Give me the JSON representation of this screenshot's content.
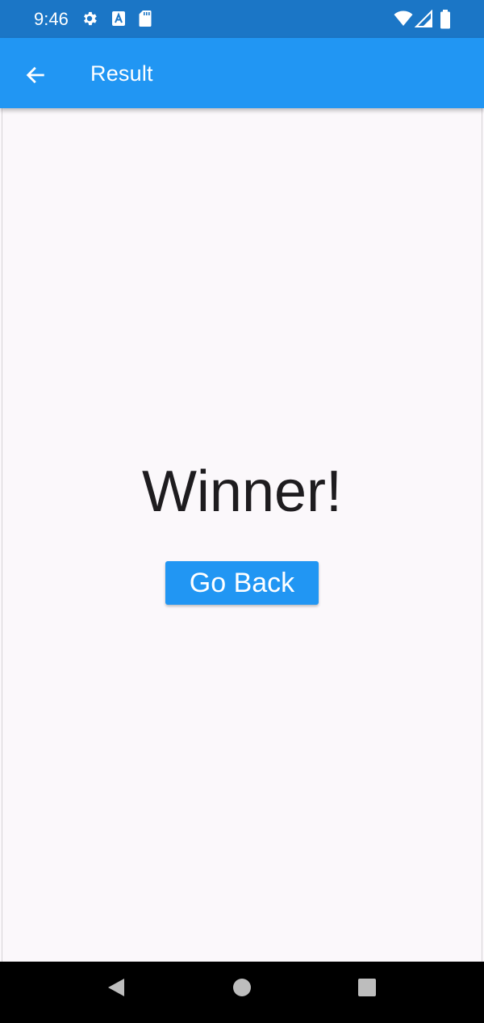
{
  "status_bar": {
    "time": "9:46",
    "left_icons": [
      "gear-icon",
      "a-badge-icon",
      "sd-card-icon"
    ],
    "right_icons": [
      "wifi-icon",
      "signal-icon",
      "battery-icon"
    ],
    "background": "#1b76c6"
  },
  "app_bar": {
    "title": "Result",
    "back_icon": "arrow-left-icon",
    "background": "#2196f3"
  },
  "main": {
    "message": "Winner!",
    "button_label": "Go Back",
    "button_color": "#2196f3",
    "background": "#fbf8fb"
  },
  "nav_bar": {
    "buttons": [
      "back-triangle-icon",
      "home-circle-icon",
      "recents-square-icon"
    ]
  }
}
